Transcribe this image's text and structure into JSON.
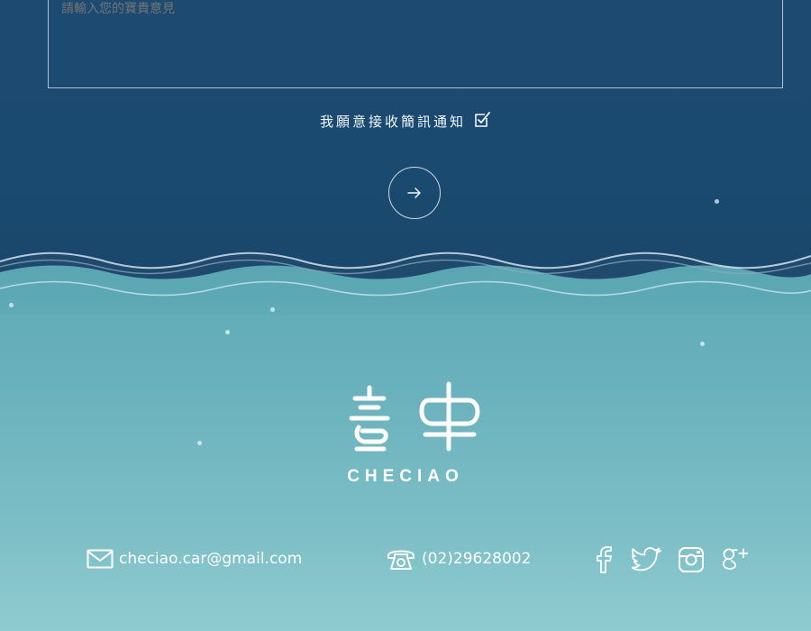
{
  "form": {
    "message_placeholder": "請輸入您的寶貴意見",
    "consent_label": "我願意接收簡訊通知",
    "consent_checked": true,
    "submit_icon": "arrow-right-icon"
  },
  "footer": {
    "logo_text": "喜車",
    "brand_name": "CHECIAO",
    "email": "checiao.car@gmail.com",
    "email_icon": "mail-icon",
    "phone": "(02)29628002",
    "phone_icon": "telephone-icon",
    "social": [
      {
        "name": "facebook",
        "icon": "facebook-icon"
      },
      {
        "name": "twitter",
        "icon": "twitter-icon"
      },
      {
        "name": "instagram",
        "icon": "instagram-icon"
      },
      {
        "name": "google-plus",
        "icon": "google-plus-icon"
      }
    ]
  },
  "colors": {
    "top_bg": "#1c4a70",
    "bottom_bg": "#6bb2bd",
    "text": "#ffffff"
  }
}
